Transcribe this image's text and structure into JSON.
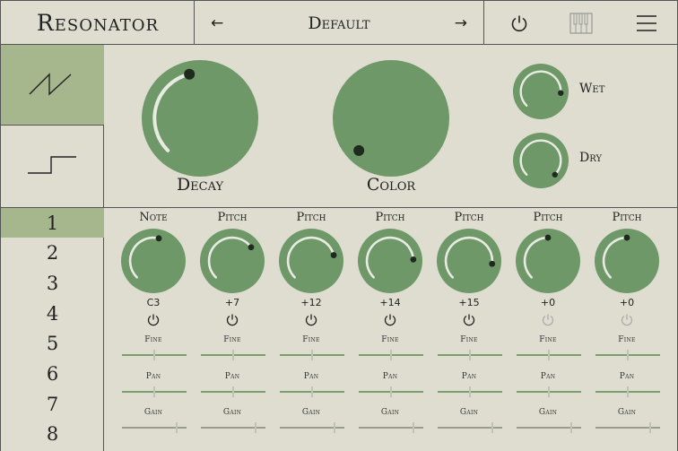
{
  "header": {
    "title": "Resonator",
    "preset_name": "Default",
    "prev_arrow": "←",
    "next_arrow": "→"
  },
  "colors": {
    "background": "#deddd0",
    "accent": "#6f9868",
    "accent_light": "#a6b78d",
    "border": "#555555"
  },
  "icons": {
    "power": "power-icon",
    "keyboard": "piano-keyboard-icon",
    "menu": "hamburger-menu-icon",
    "saw": "sawtooth-wave-icon",
    "square": "square-wave-icon"
  },
  "waveform": {
    "selected": "sawtooth",
    "options": [
      "sawtooth",
      "square"
    ]
  },
  "main_knobs": {
    "decay": {
      "label": "Decay",
      "level": 0.45
    },
    "color": {
      "label": "Color",
      "level": 0.0
    },
    "wet": {
      "label": "Wet",
      "level": 0.85
    },
    "dry": {
      "label": "Dry",
      "level": 1.0
    }
  },
  "voices": {
    "selected": "1",
    "items": [
      "1",
      "2",
      "3",
      "4",
      "5",
      "6",
      "7",
      "8"
    ]
  },
  "voice_columns": [
    {
      "header": "Note",
      "value": "C3",
      "level": 0.55,
      "power_on": true
    },
    {
      "header": "Pitch",
      "value": "+7",
      "level": 0.7,
      "power_on": true
    },
    {
      "header": "Pitch",
      "value": "+12",
      "level": 0.78,
      "power_on": true
    },
    {
      "header": "Pitch",
      "value": "+14",
      "level": 0.82,
      "power_on": true
    },
    {
      "header": "Pitch",
      "value": "+15",
      "level": 0.86,
      "power_on": true
    },
    {
      "header": "Pitch",
      "value": "+0",
      "level": 0.5,
      "power_on": false
    },
    {
      "header": "Pitch",
      "value": "+0",
      "level": 0.5,
      "power_on": false
    }
  ],
  "slider_labels": {
    "fine": "Fine",
    "pan": "Pan",
    "gain": "Gain"
  },
  "slider_values": {
    "fine": 0.5,
    "pan": 0.5,
    "gain": 0.85
  }
}
